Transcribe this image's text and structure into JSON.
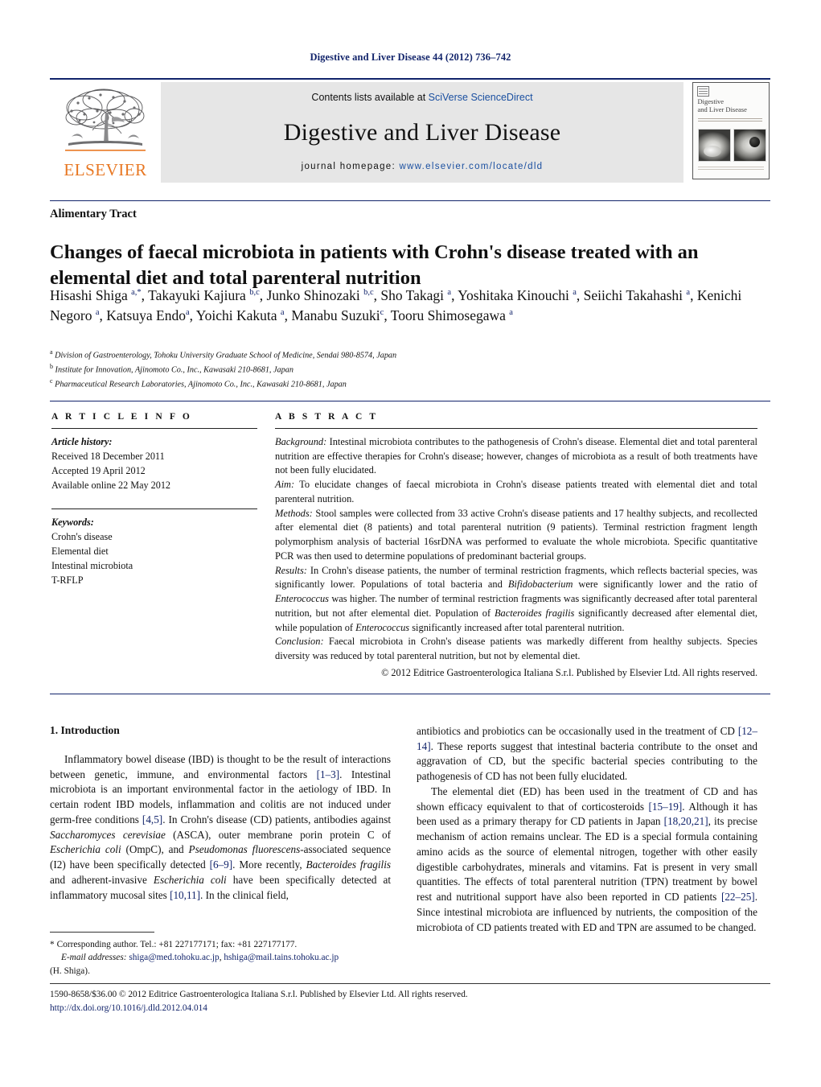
{
  "running_head": "Digestive and Liver Disease 44 (2012) 736–742",
  "masthead": {
    "contents_prefix": "Contents lists available at ",
    "contents_link": "SciVerse ScienceDirect",
    "journal_name": "Digestive and Liver Disease",
    "homepage_prefix": "journal homepage: ",
    "homepage_url": "www.elsevier.com/locate/dld",
    "publisher": "ELSEVIER",
    "cover": {
      "title_line1": "Digestive",
      "title_line2": "and Liver Disease"
    }
  },
  "article": {
    "section_label": "Alimentary Tract",
    "title": "Changes of faecal microbiota in patients with Crohn's disease treated with an elemental diet and total parenteral nutrition",
    "authors_html": "Hisashi Shiga <sup>a,*</sup>, Takayuki Kajiura <sup>b,c</sup>, Junko Shinozaki <sup>b,c</sup>, Sho Takagi <sup>a</sup>, Yoshitaka Kinouchi <sup>a</sup>, Seiichi Takahashi <sup>a</sup>, Kenichi Negoro <sup>a</sup>, Katsuya Endo<sup>a</sup>, Yoichi Kakuta <sup>a</sup>, Manabu Suzuki<sup>c</sup>, Tooru Shimosegawa <sup>a</sup>",
    "affiliations": [
      {
        "marker": "a",
        "text": "Division of Gastroenterology, Tohoku University Graduate School of Medicine, Sendai 980-8574, Japan"
      },
      {
        "marker": "b",
        "text": "Institute for Innovation, Ajinomoto Co., Inc., Kawasaki 210-8681, Japan"
      },
      {
        "marker": "c",
        "text": "Pharmaceutical Research Laboratories, Ajinomoto Co., Inc., Kawasaki 210-8681, Japan"
      }
    ]
  },
  "article_info": {
    "heading": "A R T I C L E   I N F O",
    "history_label": "Article history:",
    "history": [
      "Received 18 December 2011",
      "Accepted 19 April 2012",
      "Available online 22 May 2012"
    ],
    "keywords_label": "Keywords:",
    "keywords": [
      "Crohn's disease",
      "Elemental diet",
      "Intestinal microbiota",
      "T-RFLP"
    ]
  },
  "abstract": {
    "heading": "A B S T R A C T",
    "background_label": "Background:",
    "background": " Intestinal microbiota contributes to the pathogenesis of Crohn's disease. Elemental diet and total parenteral nutrition are effective therapies for Crohn's disease; however, changes of microbiota as a result of both treatments have not been fully elucidated.",
    "aim_label": "Aim:",
    "aim": " To elucidate changes of faecal microbiota in Crohn's disease patients treated with elemental diet and total parenteral nutrition.",
    "methods_label": "Methods:",
    "methods": " Stool samples were collected from 33 active Crohn's disease patients and 17 healthy subjects, and recollected after elemental diet (8 patients) and total parenteral nutrition (9 patients). Terminal restriction fragment length polymorphism analysis of bacterial 16srDNA was performed to evaluate the whole microbiota. Specific quantitative PCR was then used to determine populations of predominant bacterial groups.",
    "results_label": "Results:",
    "results_html": " In Crohn's disease patients, the number of terminal restriction fragments, which reflects bacterial species, was significantly lower. Populations of total bacteria and <i>Bifidobacterium</i> were significantly lower and the ratio of <i>Enterococcus</i> was higher. The number of terminal restriction fragments was significantly decreased after total parenteral nutrition, but not after elemental diet. Population of <i>Bacteroides fragilis</i> significantly decreased after elemental diet, while population of <i>Enterococcus</i> significantly increased after total parenteral nutrition.",
    "conclusion_label": "Conclusion:",
    "conclusion": " Faecal microbiota in Crohn's disease patients was markedly different from healthy subjects. Species diversity was reduced by total parenteral nutrition, but not by elemental diet.",
    "copyright": "© 2012 Editrice Gastroenterologica Italiana S.r.l. Published by Elsevier Ltd. All rights reserved."
  },
  "body": {
    "section_heading": "1.  Introduction",
    "left_paragraph_html": "Inflammatory bowel disease (IBD) is thought to be the result of interactions between genetic, immune, and environmental factors <span class=\"ref\">[1–3]</span>. Intestinal microbiota is an important environmental factor in the aetiology of IBD. In certain rodent IBD models, inflammation and colitis are not induced under germ-free conditions <span class=\"ref\">[4,5]</span>. In Crohn's disease (CD) patients, antibodies against <i class=\"sp\">Saccharomyces cerevisiae</i> (ASCA), outer membrane porin protein C of <i class=\"sp\">Escherichia coli</i> (OmpC), and <i class=\"sp\">Pseudomonas fluorescens</i>-associated sequence (I2) have been specifically detected <span class=\"ref\">[6–9]</span>. More recently, <i class=\"sp\">Bacteroides fragilis</i> and adherent-invasive <i class=\"sp\">Escherichia coli</i> have been specifically detected at inflammatory mucosal sites <span class=\"ref\">[10,11]</span>. In the clinical field,",
    "right_paragraph1_html": "antibiotics and probiotics can be occasionally used in the treatment of CD <span class=\"ref\">[12–14]</span>. These reports suggest that intestinal bacteria contribute to the onset and aggravation of CD, but the specific bacterial species contributing to the pathogenesis of CD has not been fully elucidated.",
    "right_paragraph2_html": "The elemental diet (ED) has been used in the treatment of CD and has shown efficacy equivalent to that of corticosteroids <span class=\"ref\">[15–19]</span>. Although it has been used as a primary therapy for CD patients in Japan <span class=\"ref\">[18,20,21]</span>, its precise mechanism of action remains unclear. The ED is a special formula containing amino acids as the source of elemental nitrogen, together with other easily digestible carbohydrates, minerals and vitamins. Fat is present in very small quantities. The effects of total parenteral nutrition (TPN) treatment by bowel rest and nutritional support have also been reported in CD patients <span class=\"ref\">[22–25]</span>. Since intestinal microbiota are influenced by nutrients, the composition of the microbiota of CD patients treated with ED and TPN are assumed to be changed."
  },
  "footnote": {
    "corresponding": "Corresponding author. Tel.: +81 227177171; fax: +81 227177177.",
    "email_label": "E-mail addresses:",
    "email1": "shiga@med.tohoku.ac.jp",
    "email2": "hshiga@mail.tains.tohoku.ac.jp",
    "email_owner": "(H. Shiga)."
  },
  "imprint": {
    "line1": "1590-8658/$36.00 © 2012 Editrice Gastroenterologica Italiana S.r.l. Published by Elsevier Ltd. All rights reserved.",
    "doi": "http://dx.doi.org/10.1016/j.dld.2012.04.014"
  }
}
